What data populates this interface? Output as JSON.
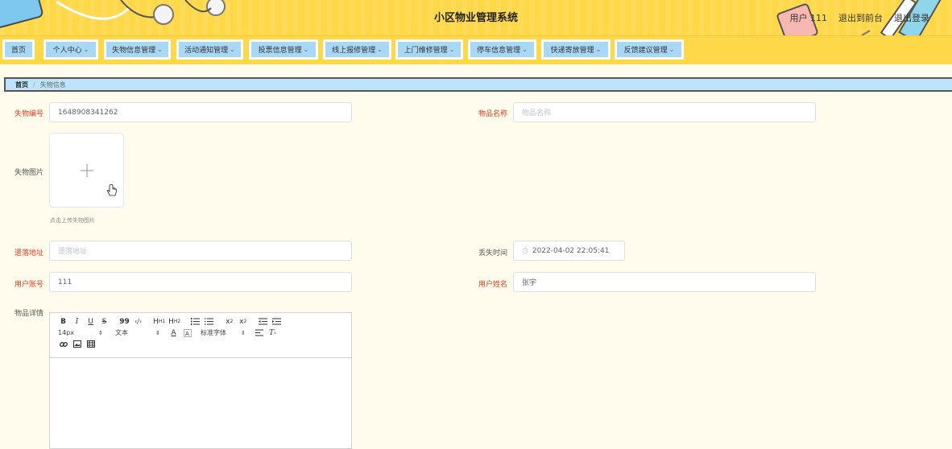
{
  "header": {
    "title": "小区物业管理系统",
    "user_label": "用户 111",
    "to_front_label": "退出到前台",
    "logout_label": "退出登录"
  },
  "nav": {
    "items": [
      {
        "label": "首页",
        "has_dropdown": false
      },
      {
        "label": "个人中心",
        "has_dropdown": true
      },
      {
        "label": "失物信息管理",
        "has_dropdown": true
      },
      {
        "label": "活动通知管理",
        "has_dropdown": true
      },
      {
        "label": "投票信息管理",
        "has_dropdown": true
      },
      {
        "label": "线上报修管理",
        "has_dropdown": true
      },
      {
        "label": "上门维修管理",
        "has_dropdown": true
      },
      {
        "label": "停车信息管理",
        "has_dropdown": true
      },
      {
        "label": "快递寄放管理",
        "has_dropdown": true
      },
      {
        "label": "反馈建议管理",
        "has_dropdown": true
      }
    ],
    "chevron": "⌄"
  },
  "breadcrumb": {
    "home": "首页",
    "separator": "/",
    "current": "失物信息"
  },
  "form": {
    "lost_no": {
      "label": "失物编号",
      "value": "1648908341262"
    },
    "item_name": {
      "label": "物品名称",
      "placeholder": "物品名称"
    },
    "image": {
      "label": "失物图片",
      "hint": "点击上传失物图片"
    },
    "lost_address": {
      "label": "遗落地址",
      "placeholder": "遗落地址"
    },
    "lost_time": {
      "label": "丢失时间",
      "value": "2022-04-02 22:05:41"
    },
    "user_account": {
      "label": "用户账号",
      "value": "111"
    },
    "user_name": {
      "label": "用户姓名",
      "value": "张宇"
    },
    "details": {
      "label": "物品详情"
    }
  },
  "editor": {
    "row1": [
      "B",
      "I",
      "U",
      "S",
      "99",
      "‹/›",
      "H1",
      "H2",
      "ol",
      "ul",
      "x2",
      "x2",
      "in",
      "out"
    ],
    "font_size": "14px",
    "text_style": "文本",
    "font_family": "标准字体",
    "select_arrow": "⇕"
  },
  "colors": {
    "header_bg": "#ffd84a",
    "nav_item_bg": "#a8d8f6",
    "page_bg": "#fffcee",
    "required_label": "#e23c1c"
  }
}
